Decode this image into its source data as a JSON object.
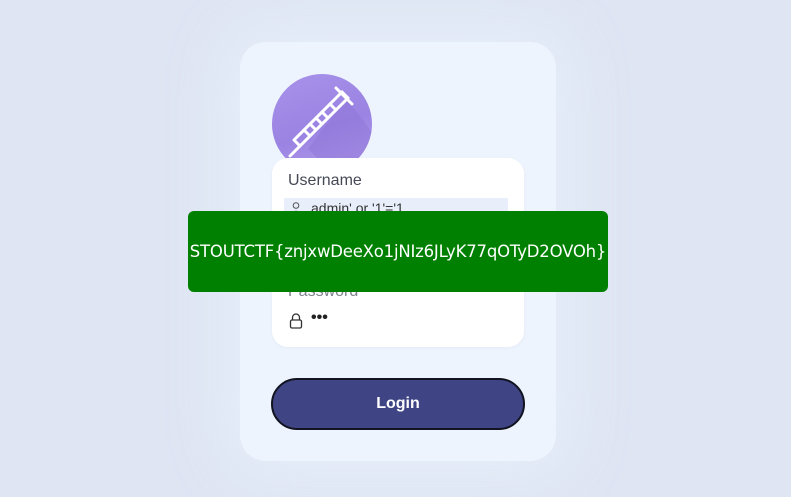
{
  "form": {
    "logo_icon": "syringe-icon",
    "username_label": "Username",
    "username_value": "admin' or '1'='1",
    "username_icon": "user-icon",
    "password_label": "Password",
    "password_value": "•••",
    "password_icon": "lock-icon",
    "login_label": "Login"
  },
  "banner": {
    "text": "STOUTCTF{znjxwDeeXo1jNIz6JLyK77qOTyD2OVOh}",
    "color": "#008000"
  },
  "colors": {
    "background": "#dfe5f3",
    "card": "#eef4fd",
    "button": "#3f4584",
    "logo": "#a792ea"
  }
}
